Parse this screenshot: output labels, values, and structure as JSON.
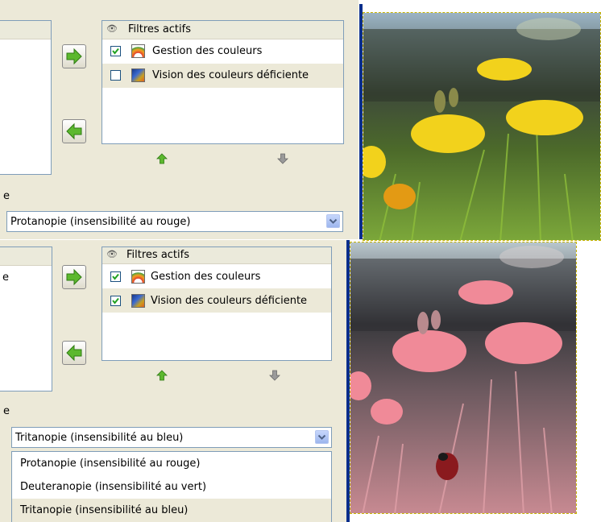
{
  "top": {
    "header_label": "Filtres actifs",
    "filters": [
      {
        "label": "Gestion des couleurs",
        "checked": true,
        "icon": "color-management-icon"
      },
      {
        "label": "Vision des couleurs déficiente",
        "checked": false,
        "icon": "color-deficient-icon"
      }
    ],
    "left_fragment": "e",
    "combo_value": "Protanopie (insensibilité au rouge)"
  },
  "bottom": {
    "header_label": "Filtres actifs",
    "filters": [
      {
        "label": "Gestion des couleurs",
        "checked": true,
        "icon": "color-management-icon"
      },
      {
        "label": "Vision des couleurs déficiente",
        "checked": true,
        "icon": "color-deficient-icon"
      }
    ],
    "left_list_fragment": "e",
    "left_fragment": "e",
    "combo_value": "Tritanopie (insensibilité au bleu)",
    "options": [
      "Protanopie (insensibilité au rouge)",
      "Deuteranopie (insensibilité au vert)",
      "Tritanopie (insensibilité au bleu)"
    ]
  },
  "colors": {
    "panel_bg": "#ece9d8",
    "divider_blue": "#0a2e8c",
    "arrow_green": "#5cb82e",
    "selection_bg": "#ece9d8"
  }
}
